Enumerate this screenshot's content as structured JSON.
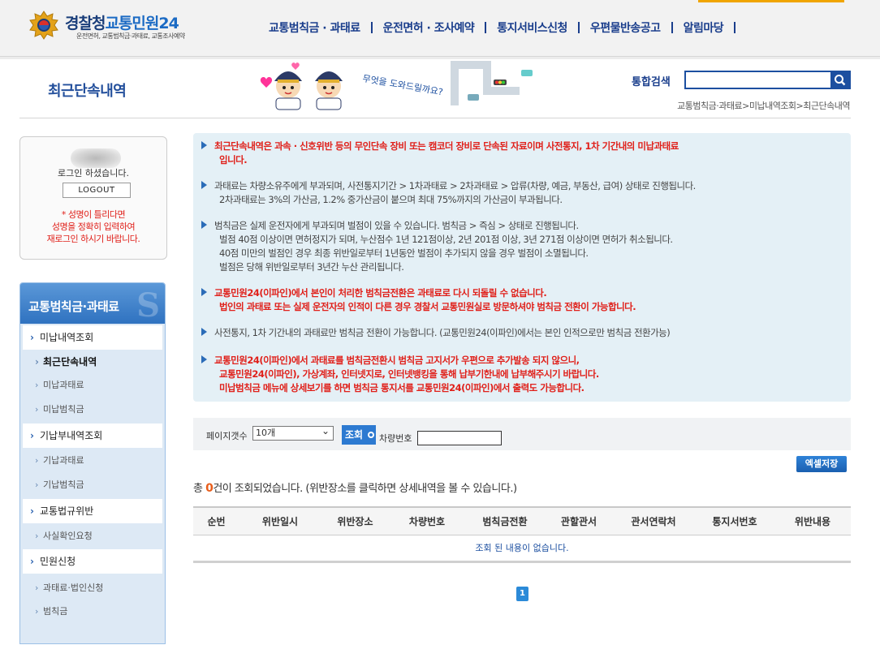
{
  "header": {
    "logo_title_a": "경찰청",
    "logo_title_b": "교통민원24",
    "logo_sub": "운전면허, 교통범칙금·과태료, 교통조사예약",
    "nav": [
      "교통범칙금 · 과태료",
      "운전면허 · 조사예약",
      "통지서비스신청",
      "우편물반송공고",
      "알림마당"
    ]
  },
  "page": {
    "title": "최근단속내역",
    "mascot_text": "무엇을 도와드릴까요?",
    "search_label": "통합검색",
    "search_placeholder": "",
    "breadcrumb": "교통범칙금·과태료>미납내역조회>최근단속내역"
  },
  "login": {
    "message": "로그인 하셨습니다.",
    "logout": "LOGOUT",
    "warning": [
      "* 성명이 틀리다면",
      "성명을 정확히 입력하여",
      "재로그인 하시기 바랍니다."
    ]
  },
  "sidebar": {
    "heading": "교통범칙금·과태료",
    "menu": [
      {
        "label": "미납내역조회",
        "level": 1
      },
      {
        "label": "최근단속내역",
        "level": 2,
        "active": true
      },
      {
        "label": "미납과태료",
        "level": 2
      },
      {
        "label": "미납범칙금",
        "level": 2
      },
      {
        "label": "기납부내역조회",
        "level": 1
      },
      {
        "label": "기납과태료",
        "level": 2
      },
      {
        "label": "기납범칙금",
        "level": 2
      },
      {
        "label": "교통법규위반",
        "level": 1
      },
      {
        "label": "사실확인요청",
        "level": 2
      },
      {
        "label": "민원신청",
        "level": 1
      },
      {
        "label": "과태료·법인신청",
        "level": 2
      },
      {
        "label": "범칙금",
        "level": 2
      }
    ]
  },
  "info": [
    {
      "style": "red",
      "lines": [
        "최근단속내역은 과속 · 신호위반 등의 무인단속 장비 또는 캠코더 장비로 단속된 자료이며 사전통지, 1차 기간내의 미납과태료",
        "입니다."
      ]
    },
    {
      "style": "blk",
      "lines": [
        "과태료는 차량소유주에게 부과되며, 사전통지기간 > 1차과태료 > 2차과태료 > 압류(차량, 예금, 부동산, 급여) 상태로 진행됩니다.",
        "2차과태료는 3%의 가산금, 1.2% 중가산금이 붙으며 최대 75%까지의 가산금이 부과됩니다."
      ]
    },
    {
      "style": "blk",
      "lines": [
        "범칙금은 실제 운전자에게 부과되며 벌점이 있을 수 있습니다. 범칙금 > 즉심 > 상태로 진행됩니다.",
        "벌점 40점 이상이면 면허정지가 되며, 누산점수 1년 121점이상, 2년 201점 이상, 3년 271점 이상이면 면허가 취소됩니다.",
        "40점 미만의 벌점인 경우 최종 위반일로부터 1년동안 벌점이 추가되지 않을 경우 벌점이 소멸됩니다.",
        "벌점은 당해 위반일로부터 3년간 누산 관리됩니다."
      ]
    },
    {
      "style": "red",
      "lines": [
        "교통민원24(이파인)에서 본인이 처리한 범칙금전환은 과태료로 다시 되돌릴 수 없습니다.",
        "법인의 과태료 또는 실제 운전자의 인적이 다른 경우 경찰서 교통민원실로 방문하셔야 범칙금 전환이 가능합니다."
      ]
    },
    {
      "style": "blk",
      "lines": [
        "사전통지, 1차 기간내의 과태료만 범칙금 전환이 가능합니다. (교통민원24(이파인)에서는 본인 인적으로만 범칙금 전환가능)"
      ]
    },
    {
      "style": "red",
      "lines": [
        "교통민원24(이파인)에서 과태료를 범칙금전환시 범칙금 고지서가 우편으로 추가발송 되지 않으니,",
        "교통민원24(이파인), 가상계좌, 인터넷지로, 인터넷뱅킹을 통해 납부기한내에 납부해주시기 바랍니다.",
        "미납범칙금 메뉴에 상세보기를 하면 범칙금 통지서를 교통민원24(이파인)에서 출력도 가능합니다."
      ]
    }
  ],
  "filter": {
    "page_size_label": "페이지갯수",
    "page_size_value": "10개",
    "search_btn": "조회",
    "plate_label": "차량번호",
    "plate_value": ""
  },
  "excel_btn": "엑셀저장",
  "result": {
    "prefix": "총 ",
    "count": "0",
    "suffix": "건이 조회되었습니다. (위반장소를 클릭하면 상세내역을 볼 수 있습니다.)"
  },
  "table": {
    "columns": [
      "순번",
      "위반일시",
      "위반장소",
      "차량번호",
      "범칙금전환",
      "관할관서",
      "관서연락처",
      "통지서번호",
      "위반내용"
    ],
    "empty": "조회 된 내용이 없습니다."
  },
  "pagination": {
    "current": "1"
  },
  "colors": {
    "brand": "#1c4fa0",
    "accent_red": "#e0201a",
    "count_orange": "#e85d1a"
  }
}
